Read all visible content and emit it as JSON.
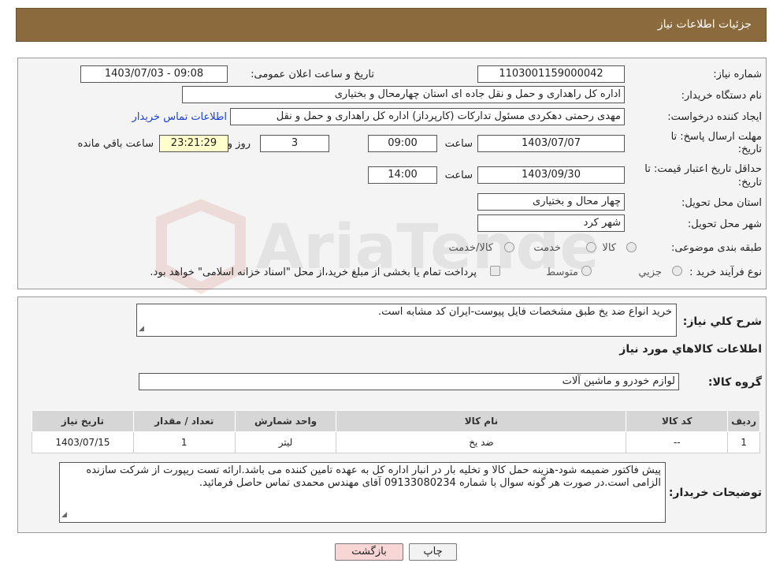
{
  "header": {
    "title": "جزئیات اطلاعات نیاز"
  },
  "details": {
    "need_number_label": "شماره نیاز:",
    "need_number": "1103001159000042",
    "announce_label": "تاریخ و ساعت اعلان عمومی:",
    "announce_value": "1403/07/03 - 09:08",
    "buyer_org_label": "نام دستگاه خریدار:",
    "buyer_org": "اداره کل راهداری و حمل و نقل جاده ای استان چهارمحال و بختیاری",
    "requester_label": "ایجاد کننده درخواست:",
    "requester": "مهدی رحمتی دهکردی مسئول تدارکات (کارپرداز) اداره کل راهداری و حمل و نقل",
    "contact_link": "اطلاعات تماس خریدار",
    "deadline_label": "مهلت ارسال پاسخ: تا تاریخ:",
    "deadline_date": "1403/07/07",
    "time_label": "ساعت",
    "deadline_time": "09:00",
    "days_value": "3",
    "days_label": "روز و",
    "remaining_time": "23:21:29",
    "remaining_label": "ساعت باقي مانده",
    "validity_label": "حداقل تاریخ اعتبار قیمت: تا تاریخ:",
    "validity_date": "1403/09/30",
    "validity_time": "14:00",
    "province_label": "استان محل تحویل:",
    "province": "چهار محال و بختیاری",
    "city_label": "شهر محل تحویل:",
    "city": "شهر کرد",
    "category_label": "طبقه بندی موضوعی:",
    "category_options": [
      "کالا",
      "خدمت",
      "کالا/خدمت"
    ],
    "process_label": "نوع فرآیند خرید :",
    "process_options": [
      "جزیي",
      "متوسط"
    ],
    "payment_note": "پرداخت تمام یا بخشی از مبلغ خرید،از محل \"اسناد خزانه اسلامی\" خواهد بود."
  },
  "summary": {
    "desc_label": "شرح کلي نیاز:",
    "desc_text": "خرید انواع ضد یخ طبق مشخصات فایل پیوست-ایران کد مشابه است.",
    "items_title": "اطلاعات کالاهاي مورد نیاز",
    "group_label": "گروه کالا:",
    "group_value": "لوازم خودرو و ماشین آلات",
    "table": {
      "headers": [
        "ردیف",
        "کد کالا",
        "نام کالا",
        "واحد شمارش",
        "تعداد / مقدار",
        "تاریخ نیاز"
      ],
      "rows": [
        [
          "1",
          "--",
          "ضد یخ",
          "لیتر",
          "1",
          "1403/07/15"
        ]
      ]
    },
    "buyer_notes_label": "توضیحات خریدار:",
    "buyer_notes": "پیش فاکتور ضمیمه شود-هزینه حمل کالا و تخلیه بار در انبار اداره کل به عهده تامین کننده می باشد.ارائه تست ریپورت از شرکت سازنده الزامی است.در صورت هر گونه سوال با شماره 09133080234 آقای مهندس محمدی تماس حاصل فرمائید."
  },
  "buttons": {
    "print": "چاپ",
    "back": "بازگشت"
  },
  "watermark": {
    "text": "AriaTender.neT"
  },
  "colors": {
    "header_bg": "#8b6a3e",
    "link": "#1a3fd0",
    "back_button": "#f8d6d6"
  }
}
